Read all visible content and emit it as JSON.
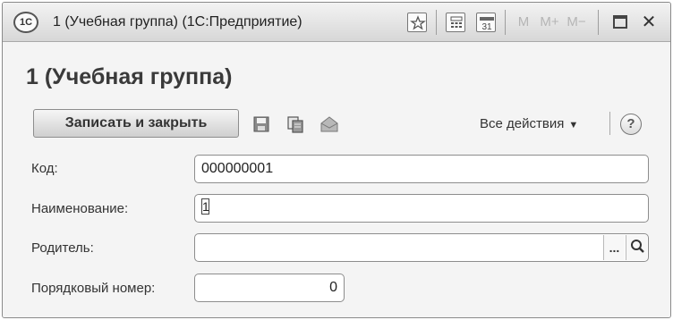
{
  "window": {
    "app_icon": "1C-logo",
    "logo_text": "1С",
    "title": "1 (Учебная группа)  (1С:Предприятие)",
    "toolbar": {
      "bookmark_icon": "bookmark-icon",
      "calculator_icon": "calculator-icon",
      "calendar_icon": "calendar-icon",
      "calendar_day": "31",
      "mem_m": "M",
      "mem_mplus": "M+",
      "mem_mminus": "M−",
      "maximize_icon": "maximize-icon",
      "close_label": "✕"
    }
  },
  "form": {
    "title": "1 (Учебная группа)",
    "command_bar": {
      "save_close_label": "Записать и закрыть",
      "save_icon": "save-icon",
      "copy_icon": "copy-icon",
      "send_icon": "envelope-icon",
      "all_actions_label": "Все действия",
      "help_label": "?"
    },
    "fields": {
      "code": {
        "label": "Код:",
        "value": "000000001"
      },
      "name": {
        "label": "Наименование:",
        "value": "1"
      },
      "parent": {
        "label": "Родитель:",
        "value": "",
        "select_label": "...",
        "search_icon": "search-icon"
      },
      "order": {
        "label": "Порядковый номер:",
        "value": "0"
      }
    }
  },
  "colors": {
    "title_bar": "#e6e6e6",
    "body": "#f4f4f4",
    "field_border": "#8d8d8d"
  }
}
